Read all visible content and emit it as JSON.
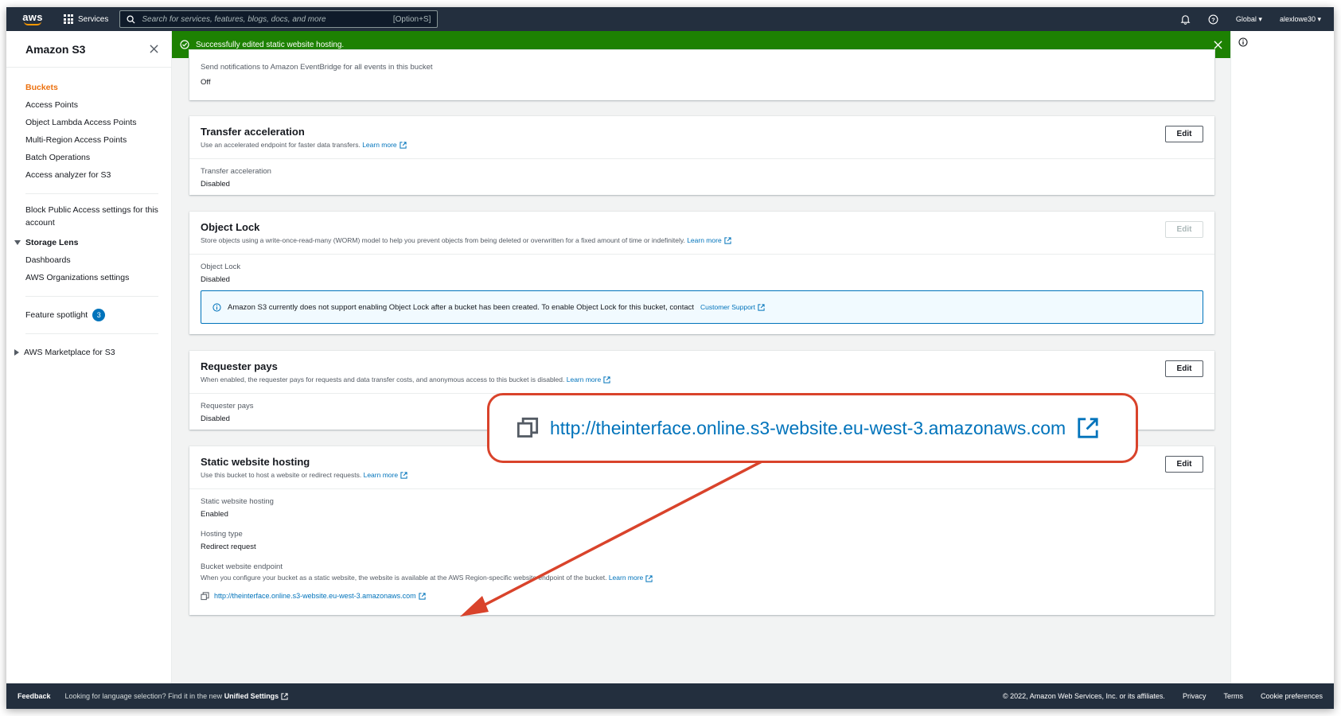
{
  "topnav": {
    "logo_text": "aws",
    "services_label": "Services",
    "search_placeholder": "Search for services, features, blogs, docs, and more",
    "search_shortcut": "[Option+S]",
    "region": "Global",
    "user": "alexlowe30"
  },
  "sidebar": {
    "title": "Amazon S3",
    "items": [
      {
        "label": "Buckets"
      },
      {
        "label": "Access Points"
      },
      {
        "label": "Object Lambda Access Points"
      },
      {
        "label": "Multi-Region Access Points"
      },
      {
        "label": "Batch Operations"
      },
      {
        "label": "Access analyzer for S3"
      }
    ],
    "block_public_access": "Block Public Access settings for this account",
    "storage_lens": {
      "label": "Storage Lens",
      "items": [
        {
          "label": "Dashboards"
        },
        {
          "label": "AWS Organizations settings"
        }
      ]
    },
    "feature_spotlight": {
      "label": "Feature spotlight",
      "count": "3"
    },
    "marketplace": "AWS Marketplace for S3"
  },
  "flash": {
    "message": "Successfully edited static website hosting."
  },
  "event_notifications": {
    "label": "Send notifications to Amazon EventBridge for all events in this bucket",
    "value": "Off"
  },
  "transfer_acceleration": {
    "title": "Transfer acceleration",
    "description": "Use an accelerated endpoint for faster data transfers.",
    "learn_more": "Learn more",
    "edit": "Edit",
    "field_label": "Transfer acceleration",
    "field_value": "Disabled"
  },
  "object_lock": {
    "title": "Object Lock",
    "description": "Store objects using a write-once-read-many (WORM) model to help you prevent objects from being deleted or overwritten for a fixed amount of time or indefinitely.",
    "learn_more": "Learn more",
    "edit": "Edit",
    "field_label": "Object Lock",
    "field_value": "Disabled",
    "alert_text": "Amazon S3 currently does not support enabling Object Lock after a bucket has been created. To enable Object Lock for this bucket, contact",
    "alert_link": "Customer Support"
  },
  "requester_pays": {
    "title": "Requester pays",
    "description": "When enabled, the requester pays for requests and data transfer costs, and anonymous access to this bucket is disabled.",
    "learn_more": "Learn more",
    "edit": "Edit",
    "field_label": "Requester pays",
    "field_value": "Disabled"
  },
  "static_hosting": {
    "title": "Static website hosting",
    "description": "Use this bucket to host a website or redirect requests.",
    "learn_more": "Learn more",
    "edit": "Edit",
    "hosting_label": "Static website hosting",
    "hosting_value": "Enabled",
    "type_label": "Hosting type",
    "type_value": "Redirect request",
    "endpoint_label": "Bucket website endpoint",
    "endpoint_desc": "When you configure your bucket as a static website, the website is available at the AWS Region-specific website endpoint of the bucket.",
    "endpoint_learn_more": "Learn more",
    "endpoint_url": "http://theinterface.online.s3-website.eu-west-3.amazonaws.com"
  },
  "callout": {
    "url": "http://theinterface.online.s3-website.eu-west-3.amazonaws.com"
  },
  "footer": {
    "feedback": "Feedback",
    "lang_text": "Looking for language selection? Find it in the new",
    "unified_settings": "Unified Settings",
    "copyright": "© 2022, Amazon Web Services, Inc. or its affiliates.",
    "privacy": "Privacy",
    "terms": "Terms",
    "cookies": "Cookie preferences"
  },
  "colors": {
    "nav_bg": "#232f3e",
    "success": "#1d8102",
    "link": "#0073bb",
    "active": "#ec7211",
    "callout_border": "#d9432b"
  }
}
